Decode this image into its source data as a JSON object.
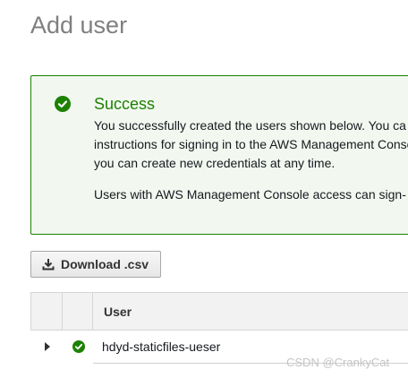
{
  "page": {
    "title": "Add user"
  },
  "success": {
    "title": "Success",
    "line1": "You successfully created the users shown below. You ca",
    "line2": "instructions for signing in to the AWS Management Conso",
    "line3": "you can create new credentials at any time.",
    "line4": "Users with AWS Management Console access can sign-"
  },
  "toolbar": {
    "download_label": "Download .csv",
    "download_icon": "download-icon"
  },
  "table": {
    "columns": [
      "",
      "",
      "User"
    ],
    "rows": [
      {
        "status_icon": "success-check-icon",
        "user": "hdyd-staticfiles-ueser"
      }
    ]
  },
  "watermark": {
    "text": "CSDN @CrankyCat"
  },
  "colors": {
    "success_green": "#1d8102",
    "success_bg": "#f2f8f0",
    "title_gray": "#7f7f7f",
    "header_bg": "#f2f2f2"
  }
}
